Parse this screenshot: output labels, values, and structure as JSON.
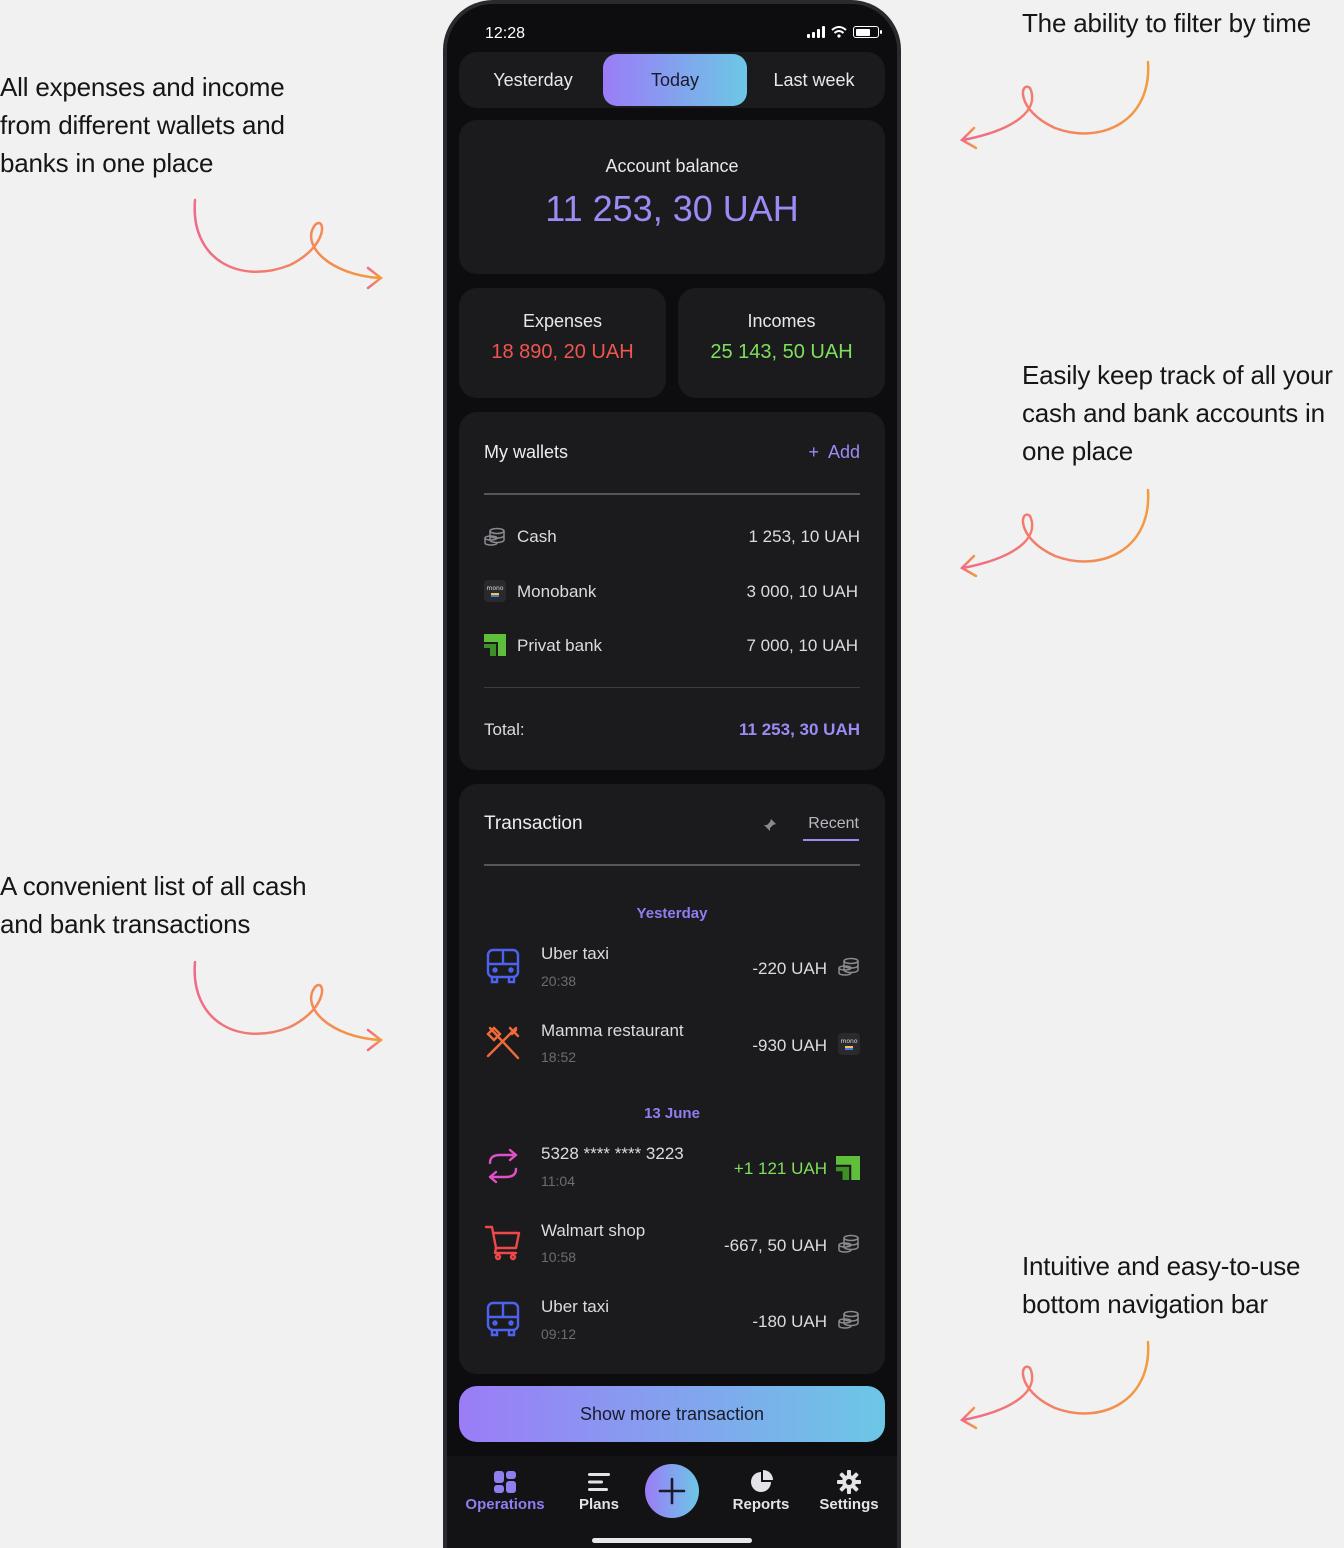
{
  "annotations": {
    "left_top": "All expenses and income from different wallets and banks in one place",
    "left_bottom": "A convenient list of all cash and bank transactions",
    "right_top": "The ability to filter by time",
    "right_middle": "Easily keep track of all your cash and bank accounts in one place",
    "right_bottom": "Intuitive and easy-to-use bottom navigation bar"
  },
  "status": {
    "time": "12:28"
  },
  "tabs": [
    {
      "label": "Yesterday",
      "active": false
    },
    {
      "label": "Today",
      "active": true
    },
    {
      "label": "Last week",
      "active": false
    }
  ],
  "balance": {
    "label": "Account balance",
    "value": "11 253, 30 UAH"
  },
  "expenses": {
    "label": "Expenses",
    "value": "18 890, 20 UAH",
    "color": "#f0554f"
  },
  "incomes": {
    "label": "Incomes",
    "value": "25 143, 50 UAH",
    "color": "#7ee05a"
  },
  "wallets": {
    "title": "My wallets",
    "add_label": "+  Add",
    "items": [
      {
        "name": "Cash",
        "amount": "1 253, 10 UAH",
        "icon": "coins-icon"
      },
      {
        "name": "Monobank",
        "amount": "3 000, 10 UAH",
        "icon": "monobank-icon"
      },
      {
        "name": "Privat bank",
        "amount": "7 000, 10 UAH",
        "icon": "privatbank-icon"
      }
    ],
    "total_label": "Total:",
    "total_value": "11 253, 30 UAH"
  },
  "transactions": {
    "title": "Transaction",
    "filter_label": "Recent",
    "groups": [
      {
        "date": "Yesterday",
        "items": [
          {
            "name": "Uber taxi",
            "time": "20:38",
            "amount": "-220 UAH",
            "icon": "bus-icon",
            "source": "coins-icon"
          },
          {
            "name": "Mamma restaurant",
            "time": "18:52",
            "amount": "-930 UAH",
            "icon": "cutlery-icon",
            "source": "monobank-icon"
          }
        ]
      },
      {
        "date": "13 June",
        "items": [
          {
            "name": "5328 **** **** 3223",
            "time": "11:04",
            "amount": "+1 121 UAH",
            "icon": "transfer-icon",
            "source": "privatbank-icon"
          },
          {
            "name": "Walmart shop",
            "time": "10:58",
            "amount": "-667, 50 UAH",
            "icon": "cart-icon",
            "source": "coins-icon"
          },
          {
            "name": "Uber taxi",
            "time": "09:12",
            "amount": "-180 UAH",
            "icon": "bus-icon",
            "source": "coins-icon"
          }
        ]
      }
    ],
    "more_label": "Show more transaction"
  },
  "nav": [
    {
      "label": "Operations",
      "icon": "grid-icon",
      "active": true
    },
    {
      "label": "Plans",
      "icon": "list-icon",
      "active": false
    },
    {
      "label": "",
      "icon": "plus-icon",
      "active": false
    },
    {
      "label": "Reports",
      "icon": "pie-icon",
      "active": false
    },
    {
      "label": "Settings",
      "icon": "gear-icon",
      "active": false
    }
  ],
  "colors": {
    "accent": "#9a8cf5",
    "income": "#7ee05a",
    "expense": "#f0554f",
    "gradient_start": "#9b7cf7",
    "gradient_end": "#6cc7e6"
  }
}
